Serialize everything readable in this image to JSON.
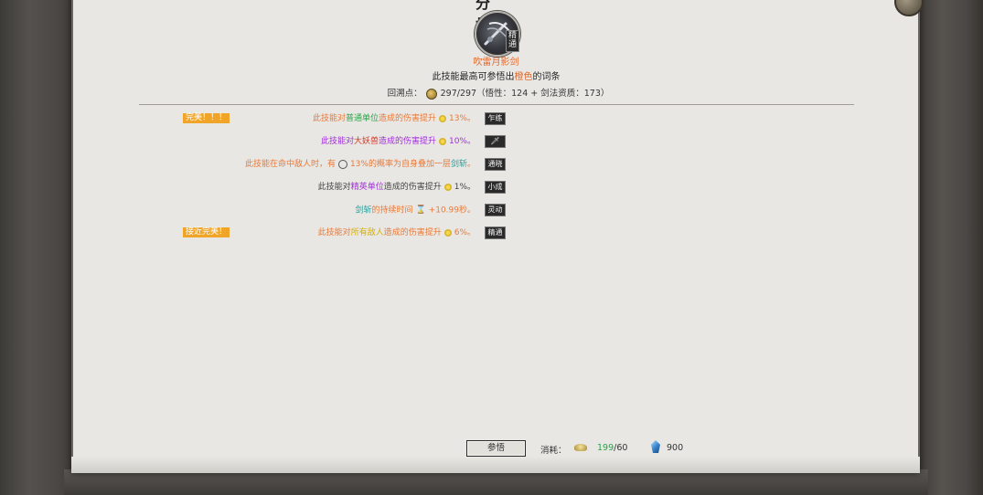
{
  "header": {
    "title_fragment": "分格",
    "skill_name": "吹雷月影剑",
    "rank_badge": "精通",
    "subtitle_pre": "此技能最高可参悟出",
    "subtitle_highlight": "橙色",
    "subtitle_post": "的词条",
    "points_label": "回溯点：",
    "points_value": "297/297（悟性：124 + 剑法资质：173）"
  },
  "entries": [
    {
      "badge": "完美！！！",
      "segments": [
        {
          "t": "此技能对",
          "c": "c-orange"
        },
        {
          "t": "普通单位",
          "c": "c-green"
        },
        {
          "t": "造成的伤害提升",
          "c": "c-orange"
        },
        {
          "icon": "sun"
        },
        {
          "t": "13%。",
          "c": "c-orange"
        }
      ],
      "tag": "乍练"
    },
    {
      "badge": "",
      "segments": [
        {
          "t": "此技能对",
          "c": "c-purple"
        },
        {
          "t": "大妖兽",
          "c": "c-red"
        },
        {
          "t": "造成的伤害提升",
          "c": "c-purple"
        },
        {
          "icon": "sun"
        },
        {
          "t": "10%。",
          "c": "c-purple"
        }
      ],
      "tag": "🗡"
    },
    {
      "badge": "",
      "segments": [
        {
          "t": "此技能在命中敌人时，有",
          "c": "c-orange"
        },
        {
          "icon": "gear"
        },
        {
          "t": "13%的概率为自身叠加一层",
          "c": "c-orange"
        },
        {
          "t": "剑斩",
          "c": "c-teal"
        },
        {
          "t": "。",
          "c": "c-orange"
        }
      ],
      "tag": "通晓"
    },
    {
      "badge": "",
      "segments": [
        {
          "t": "此技能对",
          "c": "c-gray"
        },
        {
          "t": "精英单位",
          "c": "c-purple"
        },
        {
          "t": "造成的伤害提升",
          "c": "c-gray"
        },
        {
          "icon": "sun"
        },
        {
          "t": "1%。",
          "c": "c-gray"
        }
      ],
      "tag": "小成"
    },
    {
      "badge": "",
      "segments": [
        {
          "t": "剑斩",
          "c": "c-teal"
        },
        {
          "t": "的持续时间",
          "c": "c-orange"
        },
        {
          "icon": "hourglass"
        },
        {
          "t": "+10.99秒。",
          "c": "c-orange"
        }
      ],
      "tag": "灵动"
    },
    {
      "badge": "接近完美！",
      "segments": [
        {
          "t": "此技能对",
          "c": "c-orange"
        },
        {
          "t": "所有敌人",
          "c": "c-yellow"
        },
        {
          "t": "造成的伤害提升",
          "c": "c-orange"
        },
        {
          "icon": "sun"
        },
        {
          "t": "6%。",
          "c": "c-orange"
        }
      ],
      "tag": "精通"
    }
  ],
  "footer": {
    "learn_button": "参悟",
    "cost_label": "消耗：",
    "cost_current": "199",
    "cost_required": "/60",
    "gem_value": "900"
  },
  "colors": {
    "orange": "#e97a3a",
    "green": "#2fa24a",
    "purple": "#a030d8",
    "red": "#d03a2a",
    "teal": "#2f9c9a",
    "badge": "#f0a528"
  },
  "icons": [
    "skill-icon",
    "sun-icon",
    "gear-icon",
    "hourglass-icon",
    "gold-ingot-icon",
    "gem-icon",
    "sword-icon"
  ]
}
